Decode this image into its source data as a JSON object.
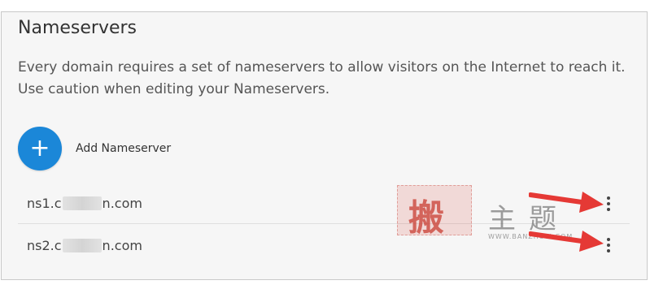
{
  "section": {
    "title": "Nameservers",
    "description": "Every domain requires a set of nameservers to allow visitors on the Internet to reach it. Use caution when editing your Nameservers."
  },
  "add_button": {
    "icon_glyph": "+",
    "label": "Add Nameserver",
    "color": "#1b87d8"
  },
  "nameservers": [
    {
      "prefix": "ns1.c",
      "suffix": "n.com"
    },
    {
      "prefix": "ns2.c",
      "suffix": "n.com"
    }
  ],
  "watermark": {
    "char_main": "搬",
    "char_2": "主",
    "char_3": "题",
    "sub_text": "WWW.BANZHUTI.COM"
  },
  "annotation_color": "#e53935"
}
